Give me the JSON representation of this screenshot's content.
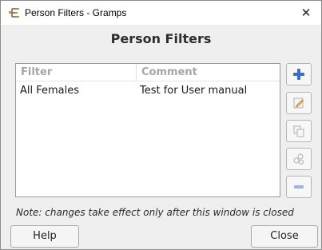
{
  "window": {
    "title": "Person Filters - Gramps"
  },
  "dialog": {
    "heading": "Person Filters",
    "note": "Note: changes take effect only after this window is closed"
  },
  "filter_list": {
    "columns": [
      "Filter",
      "Comment"
    ],
    "rows": [
      {
        "name": "All Females",
        "comment": "Test for User manual"
      }
    ]
  },
  "side_buttons": [
    "add-icon",
    "edit-icon",
    "copy-icon",
    "test-icon",
    "remove-icon"
  ],
  "buttons": {
    "help": "Help",
    "close": "Close"
  },
  "colors": {
    "accent": "#3b6fc5",
    "header_text": "#a6a6a6"
  }
}
